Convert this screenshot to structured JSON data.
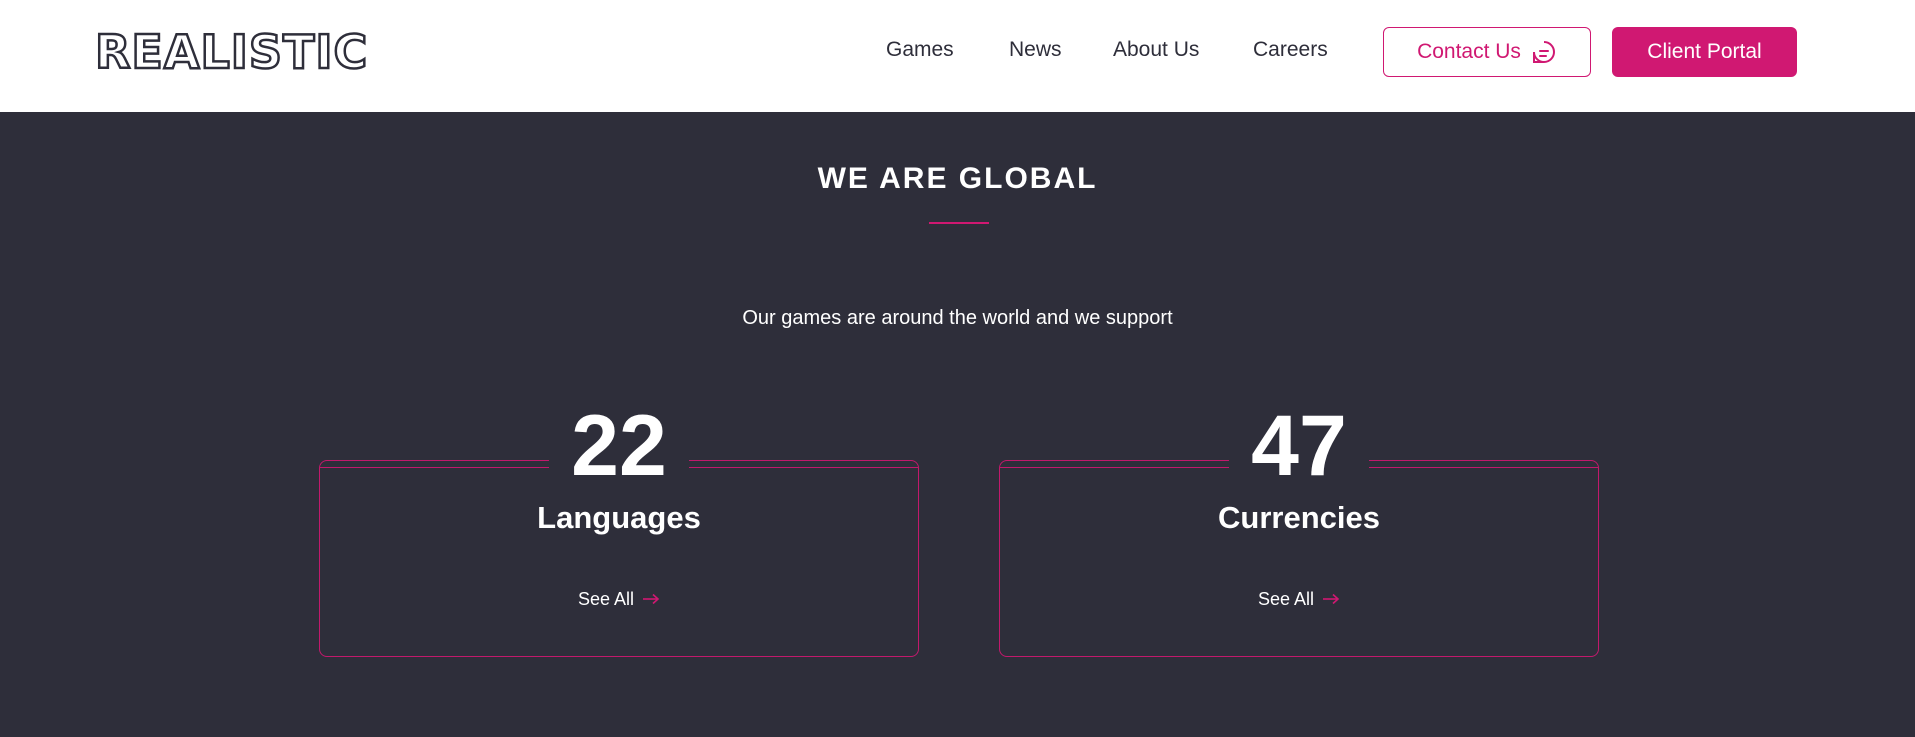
{
  "header": {
    "logo": "REALISTIC",
    "nav": [
      "Games",
      "News",
      "About Us",
      "Careers"
    ],
    "contact_label": "Contact Us",
    "portal_label": "Client Portal"
  },
  "section": {
    "title": "WE ARE GLOBAL",
    "subtitle": "Our games are around the world and we support"
  },
  "stats": [
    {
      "value": "22",
      "label": "Languages",
      "link": "See All"
    },
    {
      "value": "47",
      "label": "Currencies",
      "link": "See All"
    }
  ],
  "colors": {
    "accent": "#d01872",
    "background": "#2e2e3a",
    "header_bg": "#ffffff"
  },
  "icons": {
    "contact": "chat-bubble-icon",
    "see_all": "arrow-right-icon"
  }
}
